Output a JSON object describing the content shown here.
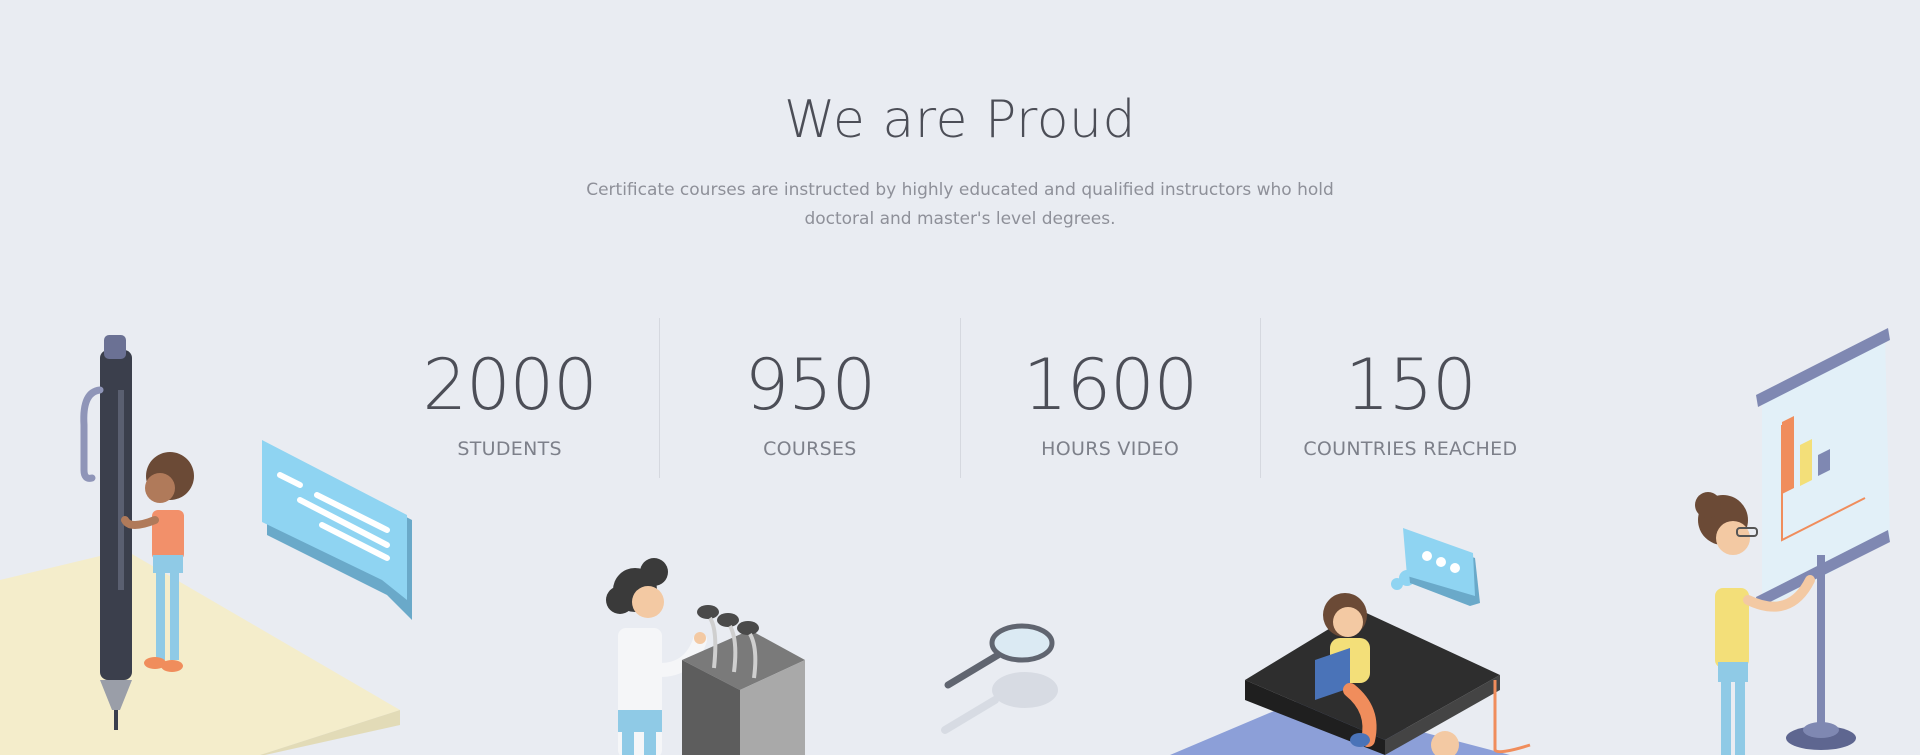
{
  "section": {
    "title": "We are Proud",
    "subtitle": "Certificate courses are instructed by highly educated and qualified instructors who hold doctoral and master's level degrees."
  },
  "stats": [
    {
      "number": "2000",
      "label": "STUDENTS"
    },
    {
      "number": "950",
      "label": "COURSES"
    },
    {
      "number": "1600",
      "label": "HOURS VIDEO"
    },
    {
      "number": "150",
      "label": "COUNTRIES REACHED"
    }
  ],
  "colors": {
    "background": "#e9ecf2",
    "heading": "#4c4e57",
    "muted": "#8e9099",
    "accent_blue": "#8fd4f2",
    "accent_orange": "#f08d5c",
    "accent_yellow": "#f3df79"
  },
  "illustrations": [
    "pen-and-student-illustration",
    "speech-bubble-icon",
    "speaker-at-podium-illustration",
    "magnifying-glass-icon",
    "student-reading-on-desk-illustration",
    "thought-bubble-icon",
    "presenter-with-chart-board-illustration"
  ]
}
